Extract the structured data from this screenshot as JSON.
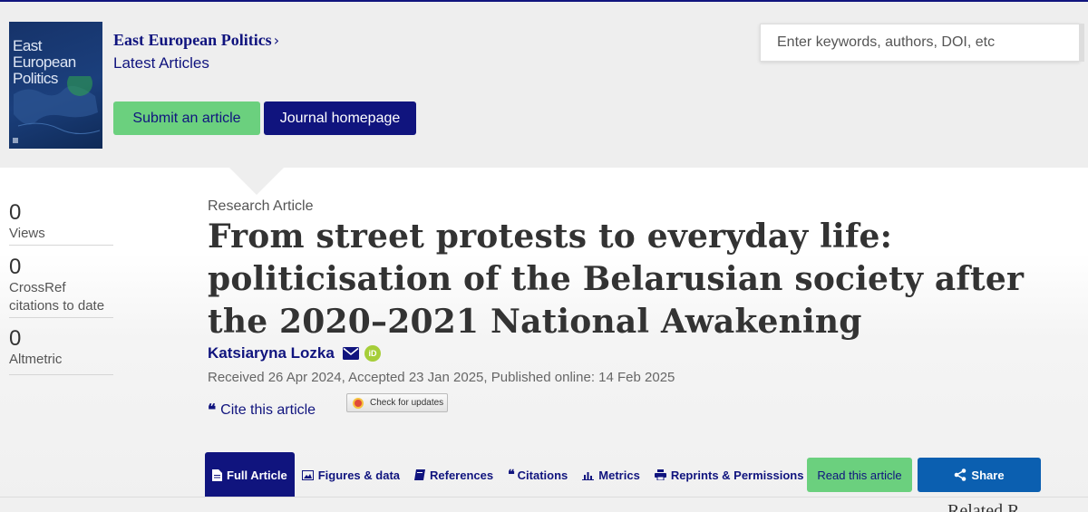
{
  "journal": {
    "cover": {
      "title_lines": [
        "East",
        "European",
        "Politics"
      ]
    },
    "name": "East European Politics",
    "latest_link": "Latest Articles",
    "submit_label": "Submit an article",
    "homepage_label": "Journal homepage"
  },
  "search": {
    "placeholder": "Enter keywords, authors, DOI, etc"
  },
  "metrics": [
    {
      "value": "0",
      "label": "Views"
    },
    {
      "value": "0",
      "label": "CrossRef citations to date"
    },
    {
      "value": "0",
      "label": "Altmetric"
    }
  ],
  "article": {
    "type": "Research Article",
    "title": "From street protests to everyday life: politicisation of the Belarusian society after the 2020–2021 National Awakening",
    "author": "Katsiaryna Lozka",
    "dates": "Received 26 Apr 2024, Accepted 23 Jan 2025, Published online: 14 Feb 2025",
    "cite_label": "Cite this article",
    "check_updates_label": "Check for updates"
  },
  "tabs": [
    {
      "label": "Full Article",
      "icon": "document-icon",
      "active": true
    },
    {
      "label": "Figures & data",
      "icon": "image-icon",
      "active": false
    },
    {
      "label": "References",
      "icon": "book-icon",
      "active": false
    },
    {
      "label": "Citations",
      "icon": "quote-icon",
      "active": false
    },
    {
      "label": "Metrics",
      "icon": "bar-chart-icon",
      "active": false
    },
    {
      "label": "Reprints & Permissions",
      "icon": "print-icon",
      "active": false
    }
  ],
  "actions": {
    "read_label": "Read this article",
    "share_label": "Share"
  },
  "related_partial": "Related R",
  "colors": {
    "navy": "#10147e",
    "green": "#6bd07e",
    "share_blue": "#0b5fb0"
  }
}
